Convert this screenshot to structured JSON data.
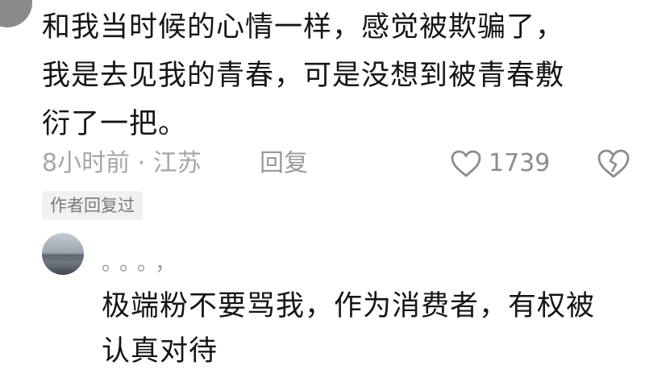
{
  "comment": {
    "text_lines": [
      "和我当时候的心情一样，感觉被欺骗了，",
      "我是去见我的青春，可是没想到被青春敷",
      "衍了一把。"
    ],
    "meta": "8小时前 · 江苏",
    "reply_label": "回复",
    "like_count": "1739",
    "like_icon": "heart-icon",
    "dislike_icon": "broken-heart-icon"
  },
  "badge": {
    "label": "作者回复过"
  },
  "reply": {
    "author": "。。。，",
    "text_lines": [
      "极端粉不要骂我，作为消费者，有权被",
      "认真对待"
    ]
  },
  "colors": {
    "text": "#151515",
    "meta": "#a6a6a6",
    "badge_bg": "#f1f1f1"
  }
}
